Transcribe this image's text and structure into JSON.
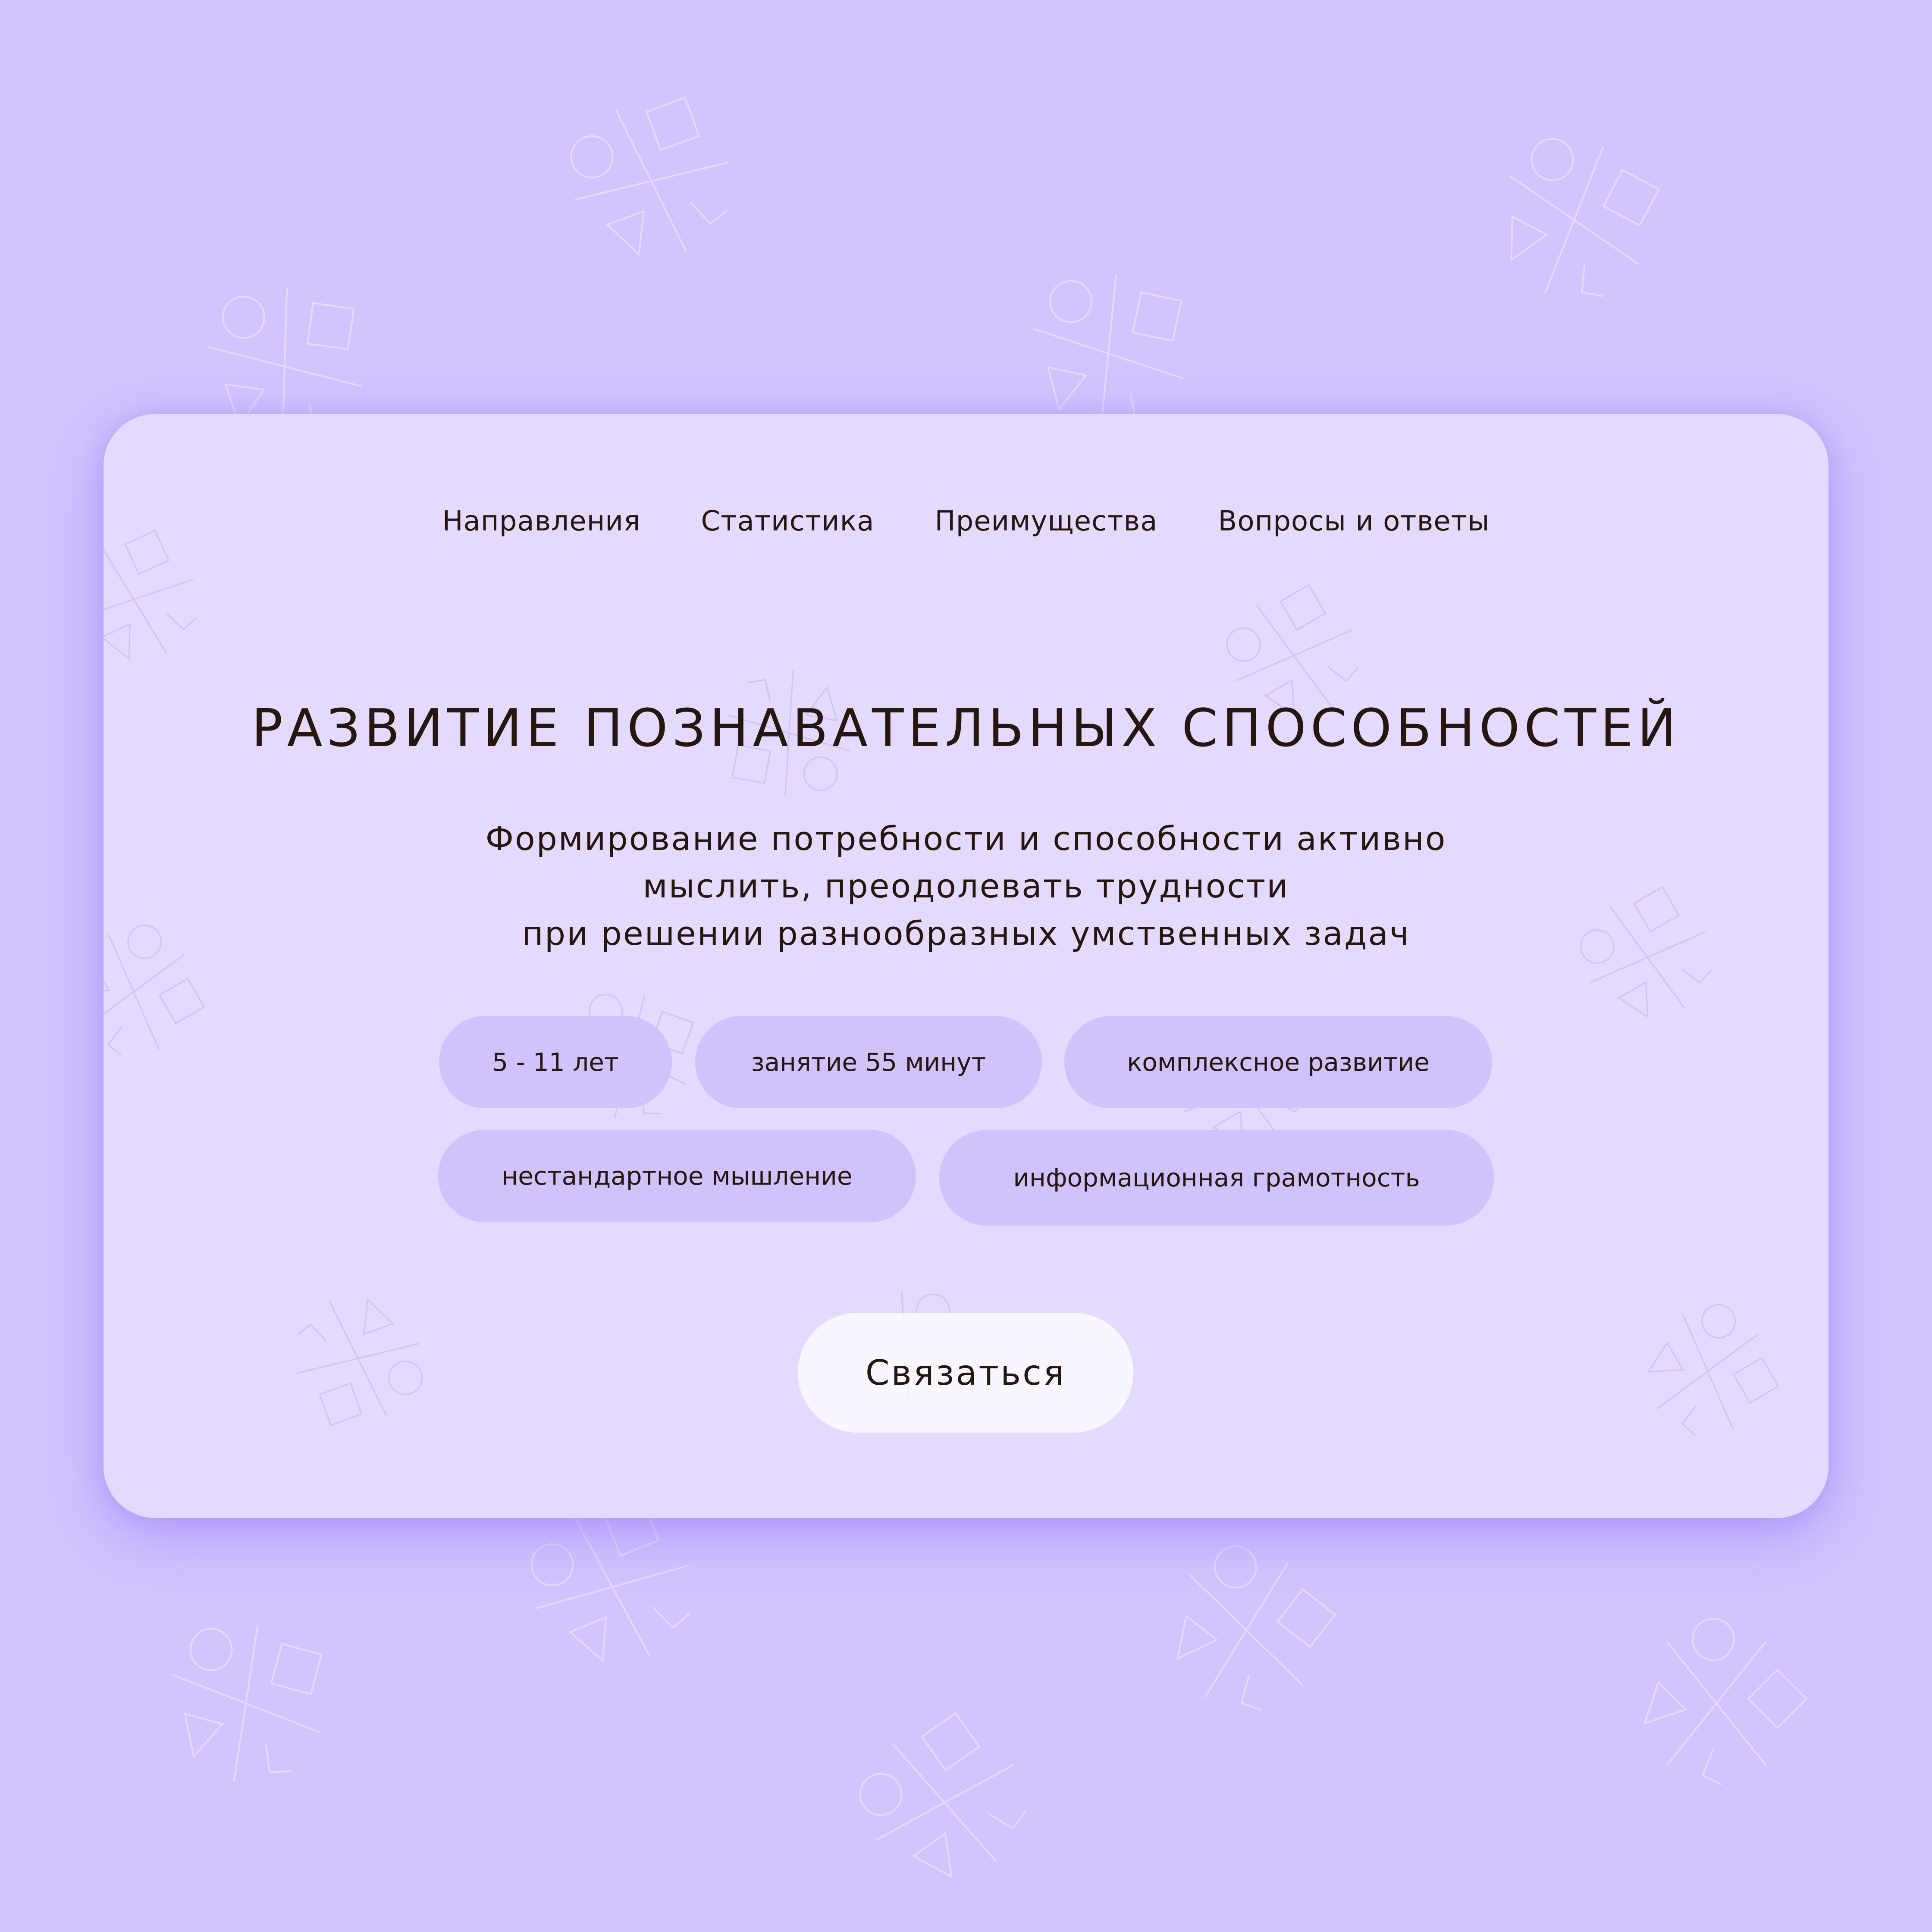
{
  "nav": {
    "items": [
      {
        "label": "Направления"
      },
      {
        "label": "Статистика"
      },
      {
        "label": "Преимущества"
      },
      {
        "label": "Вопросы и ответы"
      }
    ]
  },
  "hero": {
    "title": "РАЗВИТИЕ ПОЗНАВАТЕЛЬНЫХ СПОСОБНОСТЕЙ",
    "subtitle_lines": [
      "Формирование потребности и способности активно",
      "мыслить, преодолевать трудности",
      "при решении разнообразных умственных задач"
    ]
  },
  "tags": [
    "5 - 11 лет",
    "занятие 55 минут",
    "комплексное развитие",
    "нестандартное мышление",
    "информационная грамотность"
  ],
  "cta": {
    "label": "Связаться"
  },
  "colors": {
    "page_background": "#d2c4fe",
    "card_background": "#e4dafd",
    "pill_background": "#d0c2fd",
    "button_background": "#fbf9ff",
    "text": "#271510"
  },
  "icons": {
    "background_motif": "circle-square-triangle-chevron-cross-pattern"
  }
}
